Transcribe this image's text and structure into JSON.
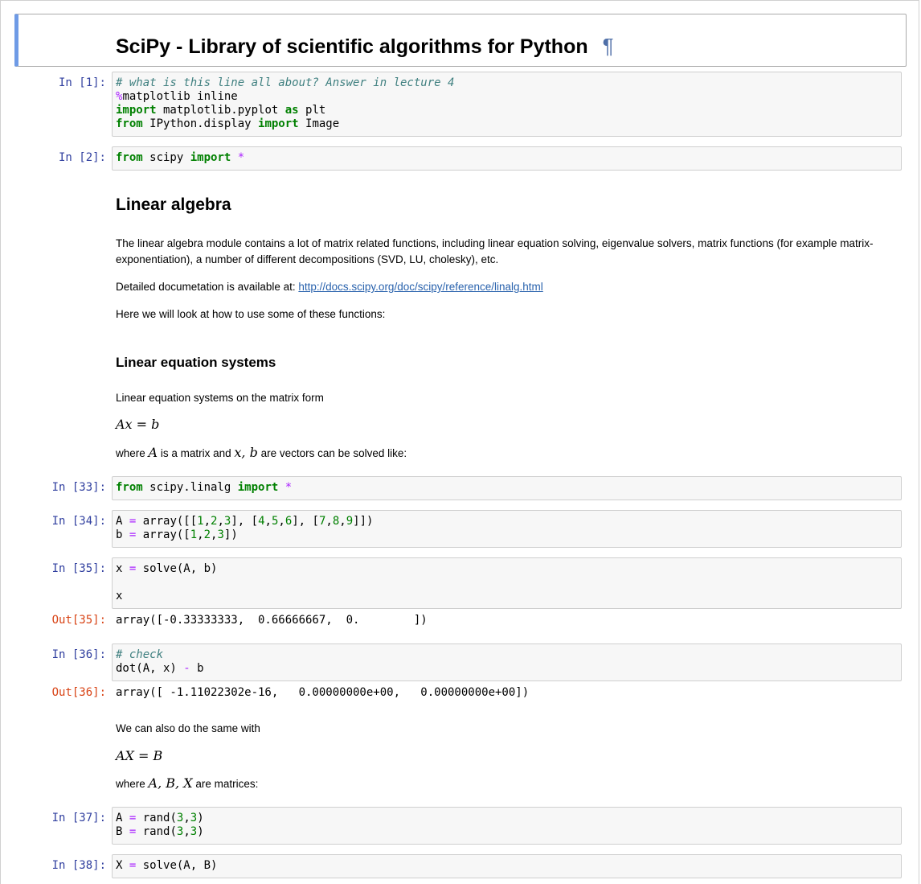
{
  "notebook": {
    "title": "SciPy - Library of scientific algorithms for Python",
    "anchor_symbol": "¶",
    "cells": [
      {
        "prompt": "In [1]:",
        "lines": [
          "# what is this line all about? Answer in lecture 4",
          "%matplotlib inline",
          "import matplotlib.pyplot as plt",
          "from IPython.display import Image"
        ]
      },
      {
        "prompt": "In [2]:",
        "lines": [
          "from scipy import *"
        ]
      },
      {
        "prompt": "In [33]:",
        "lines": [
          "from scipy.linalg import *"
        ]
      },
      {
        "prompt": "In [34]:",
        "lines": [
          "A = array([[1,2,3], [4,5,6], [7,8,9]])",
          "b = array([1,2,3])"
        ]
      },
      {
        "prompt": "In [35]:",
        "lines": [
          "x = solve(A, b)",
          "",
          "x"
        ],
        "out_prompt": "Out[35]:",
        "output": "array([-0.33333333,  0.66666667,  0.        ])"
      },
      {
        "prompt": "In [36]:",
        "lines": [
          "# check",
          "dot(A, x) - b"
        ],
        "out_prompt": "Out[36]:",
        "output": "array([ -1.11022302e-16,   0.00000000e+00,   0.00000000e+00])"
      },
      {
        "prompt": "In [37]:",
        "lines": [
          "A = rand(3,3)",
          "B = rand(3,3)"
        ]
      },
      {
        "prompt": "In [38]:",
        "lines": [
          "X = solve(A, B)"
        ]
      }
    ],
    "md": {
      "h_linear_algebra": "Linear algebra",
      "p_module": "The linear algebra module contains a lot of matrix related functions, including linear equation solving, eigenvalue solvers, matrix functions (for example matrix-exponentiation), a number of different decompositions (SVD, LU, cholesky), etc.",
      "p_docs_prefix": "Detailed documetation is available at: ",
      "docs_link": "http://docs.scipy.org/doc/scipy/reference/linalg.html",
      "p_here": "Here we will look at how to use some of these functions:",
      "h_linear_eq": "Linear equation systems",
      "p_matrix_form": "Linear equation systems on the matrix form",
      "eq_axb": "Ax = b",
      "p_where1_a": "where ",
      "p_where1_A": "A",
      "p_where1_b": " is a matrix and ",
      "p_where1_xb": "x, b",
      "p_where1_c": " are vectors can be solved like:",
      "p_also": "We can also do the same with",
      "eq_AXB": "AX = B",
      "p_where2_a": "where ",
      "p_where2_vars": "A, B, X",
      "p_where2_b": " are matrices:"
    }
  }
}
